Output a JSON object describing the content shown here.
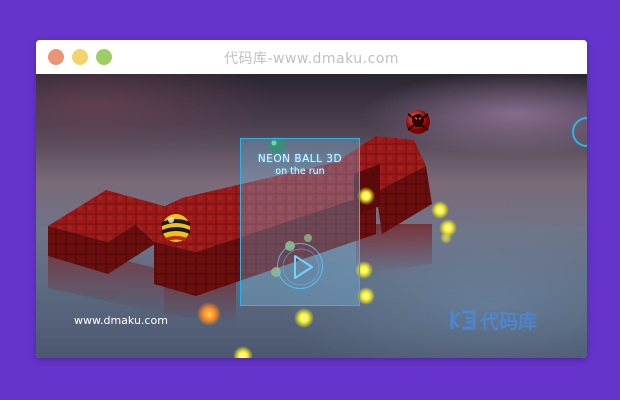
{
  "window": {
    "title": "代码库-www.dmaku.com"
  },
  "game": {
    "title": "NEON BALL 3D",
    "subtitle": "on the run",
    "play_icon": "play-icon",
    "player_ball_icon": "striped-ball-icon",
    "enemy_ball_icon": "skull-ball-icon"
  },
  "watermark": {
    "site_text": "www.dmaku.com",
    "brand_text": "代码库"
  },
  "colors": {
    "page_background": "#6633cc",
    "overlay_border": "#2ab4e8",
    "brick": "#8a1414",
    "orb": "#f4f020",
    "brand_blue": "#468ce6"
  }
}
